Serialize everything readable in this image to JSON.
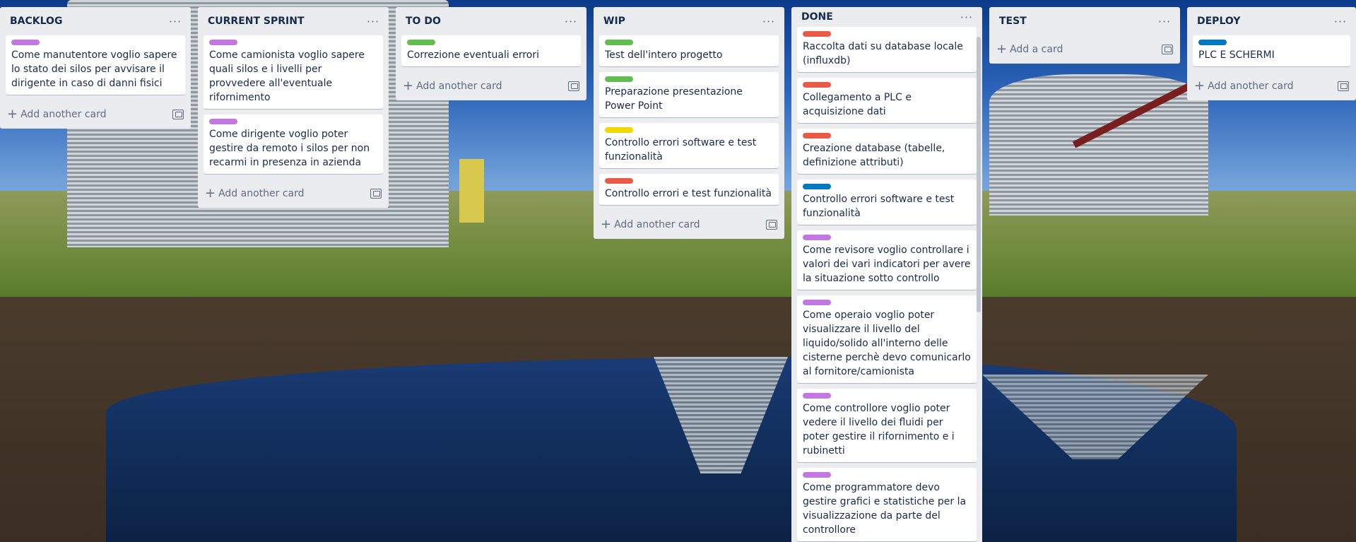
{
  "colors": {
    "purple": "#c377e0",
    "green": "#61bd4f",
    "yellow": "#f2d600",
    "red": "#eb5a46",
    "blue": "#0079bf"
  },
  "lists": [
    {
      "title": "BACKLOG",
      "menu_icon": "more-horizontal-icon",
      "cards": [
        {
          "label": "purple",
          "title": "Come manutentore voglio sapere lo stato dei silos per avvisare il dirigente in caso di danni fisici"
        }
      ],
      "add_label": "Add another card"
    },
    {
      "title": "CURRENT SPRINT",
      "menu_icon": "more-horizontal-icon",
      "cards": [
        {
          "label": "purple",
          "title": "Come camionista voglio sapere quali silos e i livelli per provvedere all'eventuale rifornimento"
        },
        {
          "label": "purple",
          "title": "Come dirigente voglio poter gestire da remoto i silos per non recarmi in presenza in azienda"
        }
      ],
      "add_label": "Add another card"
    },
    {
      "title": "TO DO",
      "menu_icon": "more-horizontal-icon",
      "cards": [
        {
          "label": "green",
          "title": "Correzione eventuali errori"
        }
      ],
      "add_label": "Add another card"
    },
    {
      "title": "WIP",
      "menu_icon": "more-horizontal-icon",
      "cards": [
        {
          "label": "green",
          "title": "Test dell'intero progetto"
        },
        {
          "label": "green",
          "title": "Preparazione presentazione Power Point"
        },
        {
          "label": "yellow",
          "title": "Controllo errori software e test funzionalità"
        },
        {
          "label": "red",
          "title": "Controllo errori e test funzionalità"
        }
      ],
      "add_label": "Add another card"
    },
    {
      "title": "DONE",
      "menu_icon": "more-horizontal-icon",
      "cards": [
        {
          "label": "red",
          "title": "Raccolta dati su database locale (influxdb)"
        },
        {
          "label": "red",
          "title": "Collegamento a PLC e acquisizione dati"
        },
        {
          "label": "red",
          "title": "Creazione database (tabelle, definizione attributi)"
        },
        {
          "label": "blue",
          "title": "Controllo errori software e test funzionalità"
        },
        {
          "label": "purple",
          "title": "Come revisore voglio controllare i valori dei vari indicatori per avere la situazione sotto controllo"
        },
        {
          "label": "purple",
          "title": "Come operaio voglio poter visualizzare il livello del liquido/solido all'interno delle cisterne perchè devo comunicarlo al fornitore/camionista"
        },
        {
          "label": "purple",
          "title": "Come controllore voglio poter vedere il livello dei fluidi per poter gestire il rifornimento e i rubinetti"
        },
        {
          "label": "purple",
          "title": "Come programmatore devo gestire grafici e statistiche per la visualizzazione da parte del controllore"
        }
      ],
      "add_label": ""
    },
    {
      "title": "TEST",
      "menu_icon": "more-horizontal-icon",
      "cards": [],
      "add_label": "Add a card"
    },
    {
      "title": "DEPLOY",
      "menu_icon": "more-horizontal-icon",
      "cards": [
        {
          "label": "blue",
          "title": "PLC E SCHERMI"
        }
      ],
      "add_label": "Add another card"
    }
  ]
}
